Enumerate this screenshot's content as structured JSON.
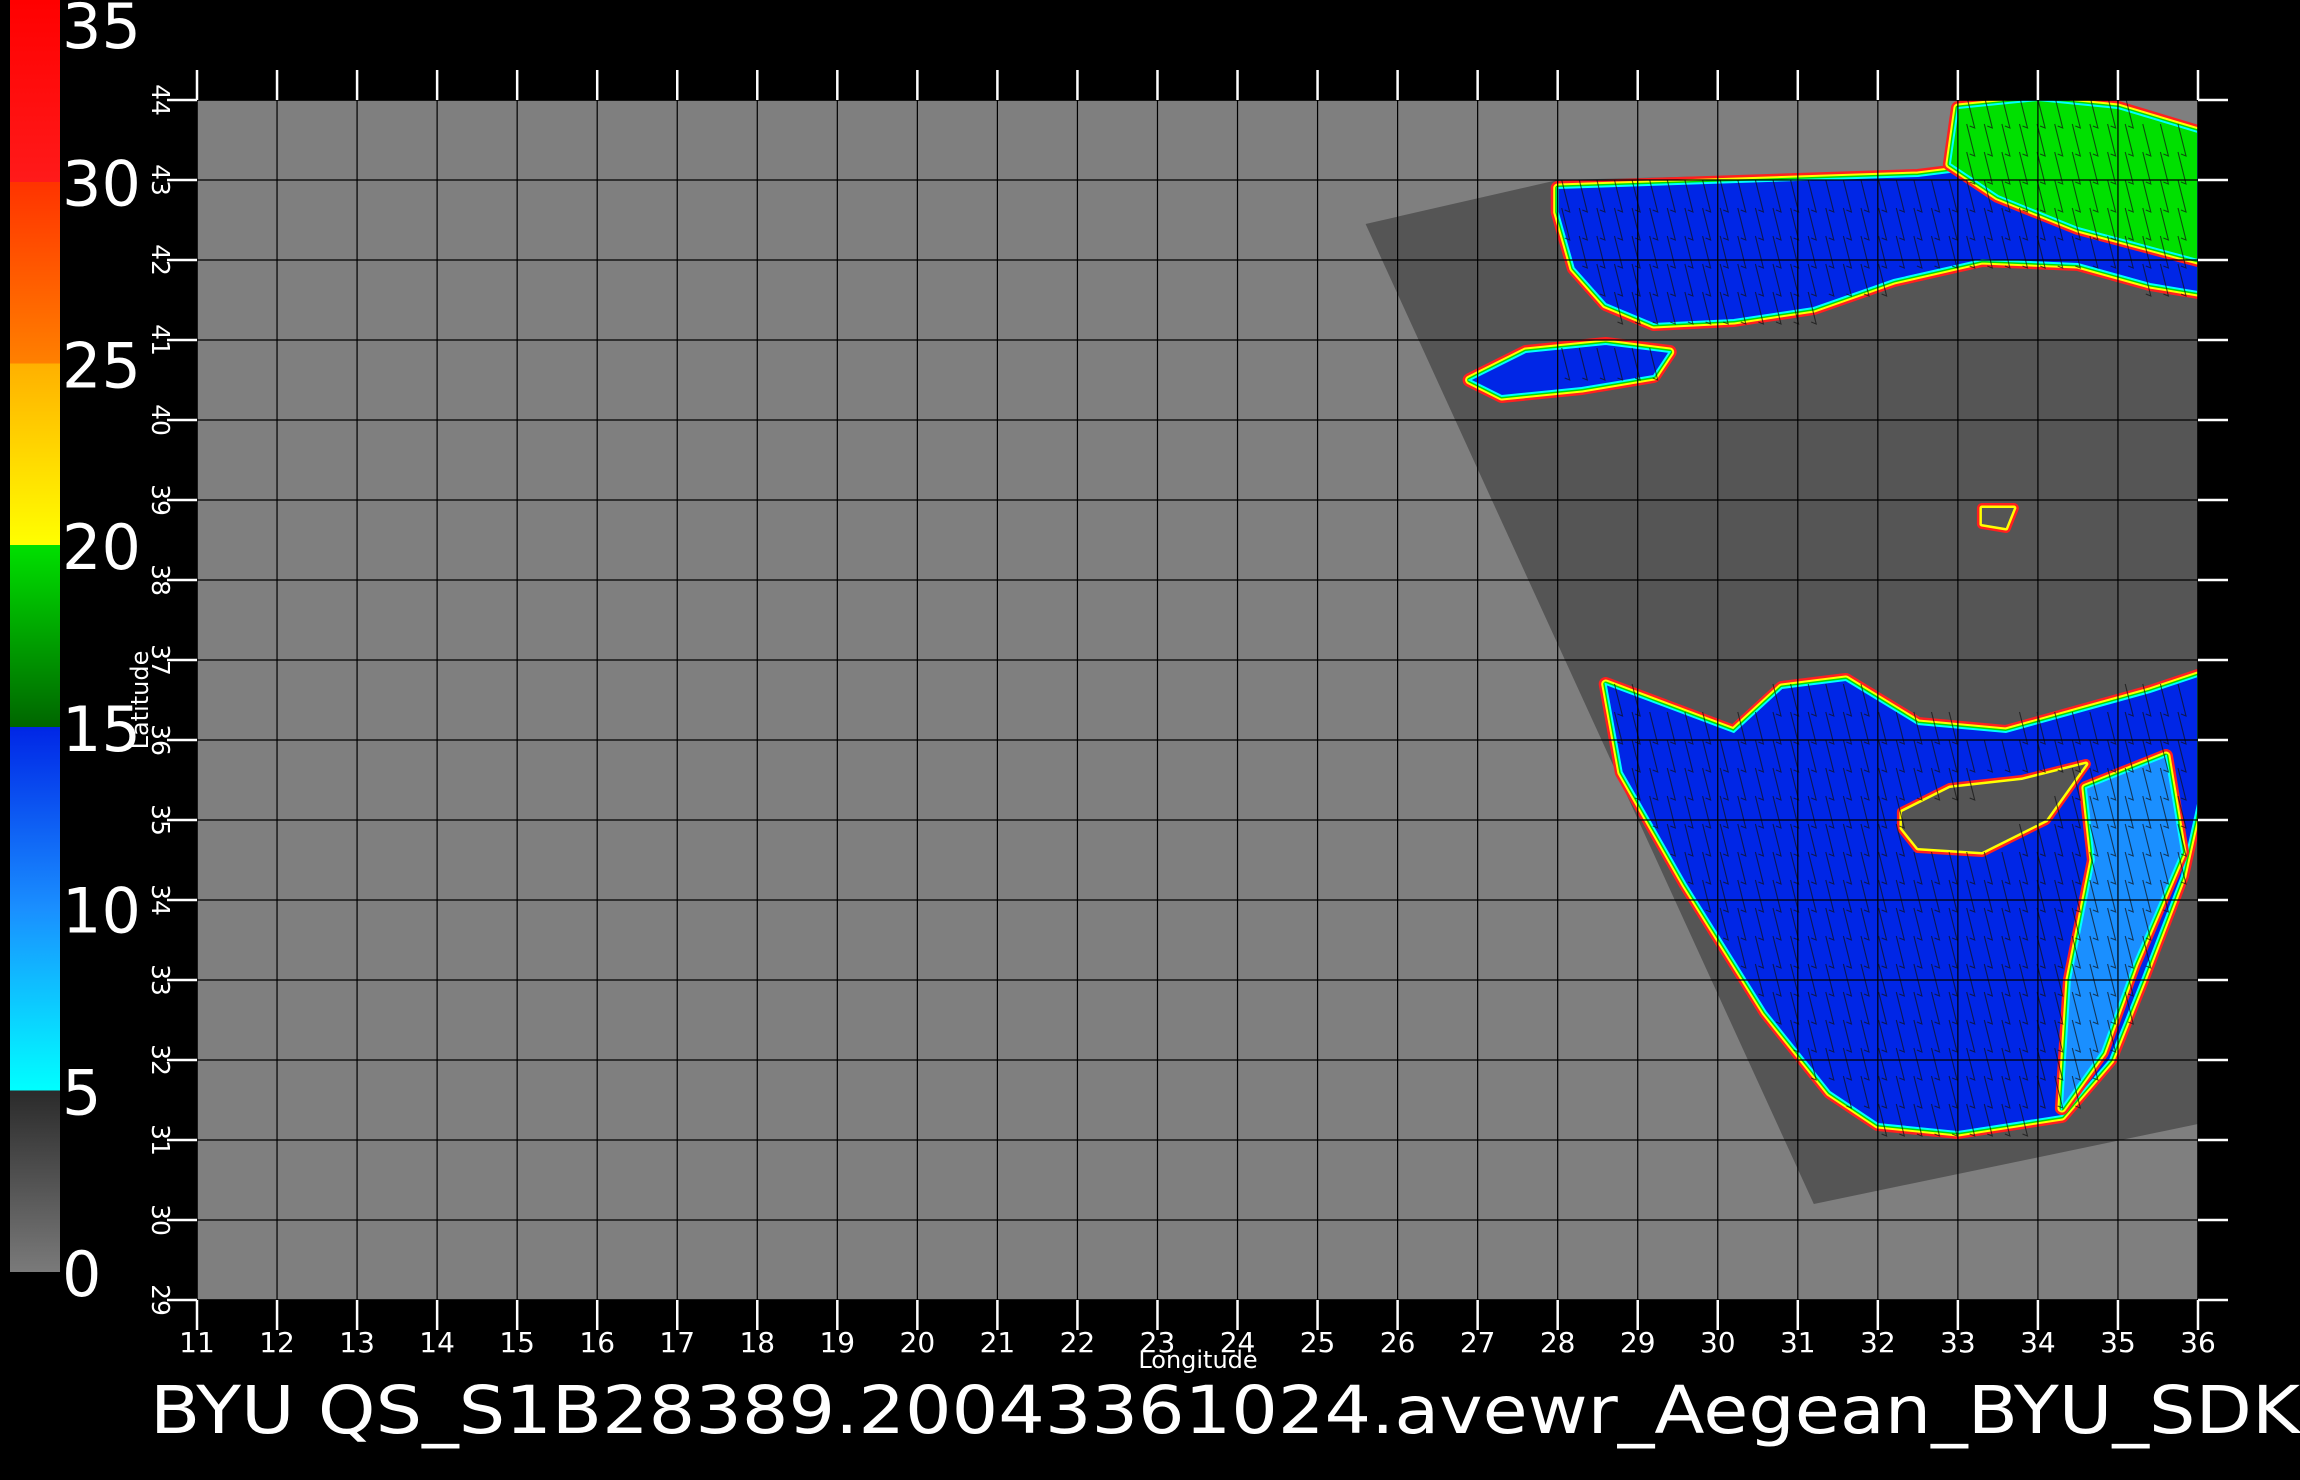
{
  "chart_data": {
    "type": "heatmap",
    "title": "BYU  QS_S1B28389.20043361024.avewr_Aegean_BYU_SDK",
    "xlabel": "Longitude",
    "ylabel": "Latitude",
    "xlim": [
      11,
      36
    ],
    "ylim": [
      29,
      44
    ],
    "x_ticks": [
      11,
      12,
      13,
      14,
      15,
      16,
      17,
      18,
      19,
      20,
      21,
      22,
      23,
      24,
      25,
      26,
      27,
      28,
      29,
      30,
      31,
      32,
      33,
      34,
      35,
      36
    ],
    "y_ticks": [
      29,
      30,
      31,
      32,
      33,
      34,
      35,
      36,
      37,
      38,
      39,
      40,
      41,
      42,
      43,
      44
    ],
    "grid": true,
    "colorbar": {
      "placement": "left",
      "range": [
        0,
        35
      ],
      "tick_labels": [
        "0",
        "5",
        "10",
        "15",
        "20",
        "25",
        "30",
        "35"
      ],
      "segments": [
        {
          "from": 0,
          "to": 5,
          "colors": [
            "#7a7a7a",
            "#2a2a2a"
          ]
        },
        {
          "from": 5,
          "to": 10,
          "colors": [
            "#00ffff",
            "#1a8fff"
          ]
        },
        {
          "from": 10,
          "to": 15,
          "colors": [
            "#1a8fff",
            "#0026e6"
          ]
        },
        {
          "from": 15,
          "to": 20,
          "colors": [
            "#006600",
            "#00e000"
          ]
        },
        {
          "from": 20,
          "to": 25,
          "colors": [
            "#ffff00",
            "#ffb000"
          ]
        },
        {
          "from": 25,
          "to": 30,
          "colors": [
            "#ff8000",
            "#ff3300"
          ]
        },
        {
          "from": 30,
          "to": 35,
          "colors": [
            "#ff1a1a",
            "#ff0000"
          ]
        },
        {
          "from": 35,
          "to": 36,
          "colors": [
            "#c08060",
            "#c08060"
          ]
        }
      ]
    },
    "colors": {
      "background": "#000000",
      "plot_area": "#7f7f7f",
      "swath_land": "#555555",
      "grid": "#000000"
    },
    "swath_corners_lonlat": [
      [
        25.6,
        42.45
      ],
      [
        28.0,
        43.0
      ],
      [
        36.0,
        43.2
      ],
      [
        36.0,
        31.2
      ],
      [
        31.2,
        30.2
      ]
    ],
    "sea_regions": [
      {
        "name": "black-sea",
        "polygon": [
          [
            28.0,
            42.9
          ],
          [
            29.5,
            42.95
          ],
          [
            32.5,
            43.05
          ],
          [
            34.5,
            43.3
          ],
          [
            36.0,
            43.4
          ],
          [
            36.0,
            41.6
          ],
          [
            35.4,
            41.7
          ],
          [
            34.5,
            41.95
          ],
          [
            33.3,
            42.0
          ],
          [
            32.2,
            41.75
          ],
          [
            31.2,
            41.4
          ],
          [
            30.2,
            41.25
          ],
          [
            29.2,
            41.2
          ],
          [
            28.6,
            41.45
          ],
          [
            28.2,
            41.9
          ],
          [
            28.0,
            42.6
          ]
        ],
        "mean_speed": 11
      },
      {
        "name": "black-sea-northeast",
        "polygon": [
          [
            33.0,
            43.9
          ],
          [
            34.0,
            44.0
          ],
          [
            35.0,
            43.9
          ],
          [
            36.0,
            43.6
          ],
          [
            36.0,
            42.0
          ],
          [
            34.5,
            42.4
          ],
          [
            33.5,
            42.8
          ],
          [
            32.9,
            43.2
          ]
        ],
        "mean_speed": 17
      },
      {
        "name": "marmara-sea",
        "polygon": [
          [
            26.9,
            40.5
          ],
          [
            27.6,
            40.85
          ],
          [
            28.6,
            40.95
          ],
          [
            29.4,
            40.85
          ],
          [
            29.2,
            40.55
          ],
          [
            28.3,
            40.4
          ],
          [
            27.3,
            40.3
          ]
        ],
        "mean_speed": 11
      },
      {
        "name": "eastern-mediterranean",
        "polygon": [
          [
            28.6,
            36.7
          ],
          [
            29.4,
            36.4
          ],
          [
            30.2,
            36.1
          ],
          [
            30.8,
            36.65
          ],
          [
            31.6,
            36.75
          ],
          [
            32.5,
            36.2
          ],
          [
            33.6,
            36.1
          ],
          [
            34.5,
            36.35
          ],
          [
            35.4,
            36.6
          ],
          [
            36.0,
            36.8
          ],
          [
            36.0,
            35.2
          ],
          [
            35.8,
            34.3
          ],
          [
            35.3,
            33.0
          ],
          [
            34.9,
            32.0
          ],
          [
            34.3,
            31.3
          ],
          [
            33.0,
            31.1
          ],
          [
            32.0,
            31.2
          ],
          [
            31.4,
            31.6
          ],
          [
            30.6,
            32.6
          ],
          [
            29.6,
            34.2
          ],
          [
            28.8,
            35.6
          ]
        ],
        "mean_speed": 10
      },
      {
        "name": "levant-strip",
        "polygon": [
          [
            34.6,
            35.4
          ],
          [
            35.6,
            35.8
          ],
          [
            35.8,
            34.6
          ],
          [
            35.2,
            33.2
          ],
          [
            34.8,
            32.1
          ],
          [
            34.3,
            31.4
          ],
          [
            34.4,
            33.0
          ],
          [
            34.7,
            34.5
          ]
        ],
        "mean_speed": 6
      }
    ],
    "land_islands": [
      {
        "name": "cyprus",
        "polygon": [
          [
            32.3,
            35.1
          ],
          [
            32.9,
            35.4
          ],
          [
            33.8,
            35.5
          ],
          [
            34.6,
            35.7
          ],
          [
            34.1,
            35.0
          ],
          [
            33.3,
            34.6
          ],
          [
            32.5,
            34.65
          ],
          [
            32.3,
            34.9
          ]
        ]
      },
      {
        "name": "small-island",
        "polygon": [
          [
            33.3,
            38.9
          ],
          [
            33.7,
            38.9
          ],
          [
            33.6,
            38.65
          ],
          [
            33.3,
            38.7
          ]
        ]
      }
    ],
    "wind_vectors": "dense field of short black vectors over sea regions, oriented roughly north-south with slight westward tilt"
  }
}
